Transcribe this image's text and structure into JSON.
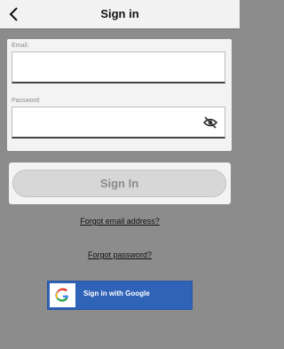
{
  "header": {
    "title": "Sign in",
    "back_icon": "chevron-left-icon"
  },
  "form": {
    "email": {
      "label": "Email:",
      "value": ""
    },
    "password": {
      "label": "Password:",
      "value": "",
      "toggle_icon": "eye-off-icon"
    }
  },
  "actions": {
    "signin_label": "Sign In",
    "forgot_email": "Forgot email address?",
    "forgot_password": "Forgot password?",
    "google_label": "Sign in with Google",
    "google_icon": "google-icon"
  },
  "colors": {
    "overlay": "#8c8c8c",
    "card": "#f3f3f3",
    "button_disabled": "#d7d7d7",
    "google_blue": "#2f63b8"
  }
}
